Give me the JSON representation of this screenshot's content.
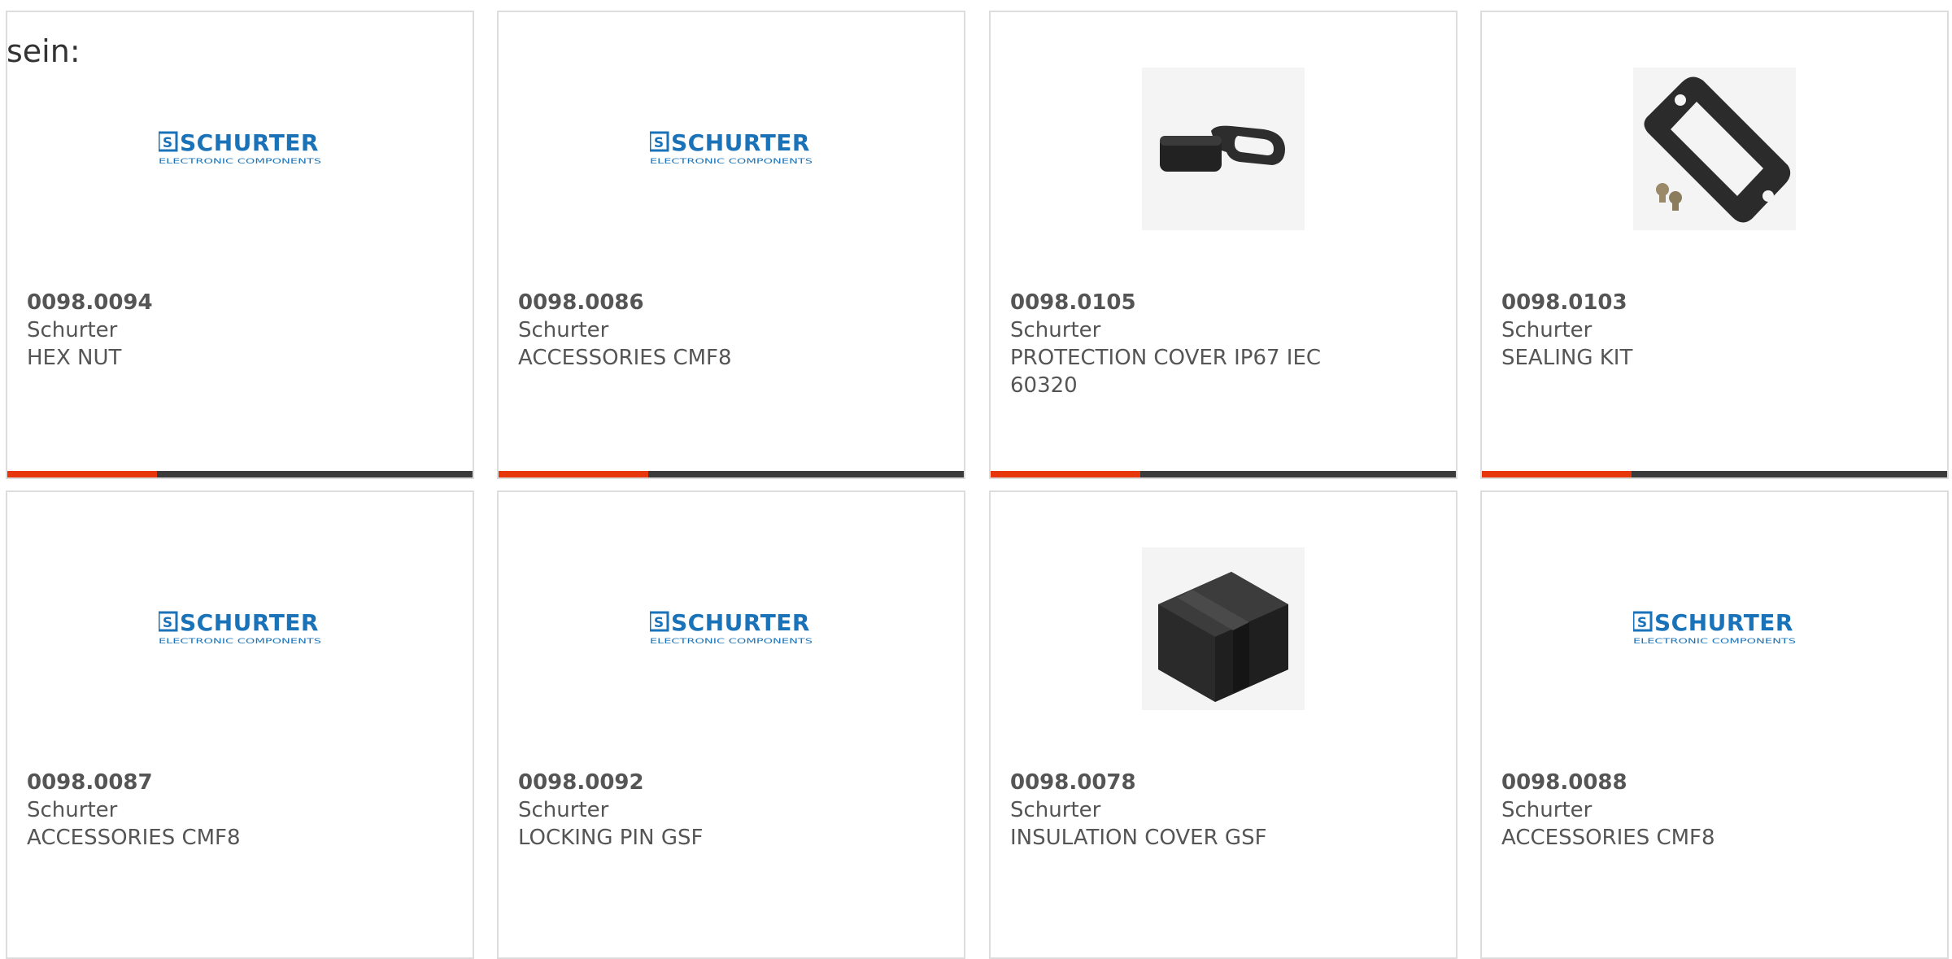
{
  "intro_text": "sein:",
  "colors": {
    "accent": "#e8360c",
    "bar": "#3b3b3b",
    "brand_blue": "#1a73b8"
  },
  "logo": {
    "brand": "SCHURTER",
    "tagline": "ELECTRONIC COMPONENTS",
    "mark": "S"
  },
  "products": [
    {
      "part_number": "0098.0094",
      "manufacturer": "Schurter",
      "description": "HEX NUT",
      "image": "schurter-logo"
    },
    {
      "part_number": "0098.0086",
      "manufacturer": "Schurter",
      "description": "ACCESSORIES CMF8",
      "image": "schurter-logo"
    },
    {
      "part_number": "0098.0105",
      "manufacturer": "Schurter",
      "description": "PROTECTION COVER IP67 IEC 60320",
      "image": "protection-cover"
    },
    {
      "part_number": "0098.0103",
      "manufacturer": "Schurter",
      "description": "SEALING KIT",
      "image": "sealing-gasket"
    },
    {
      "part_number": "0098.0087",
      "manufacturer": "Schurter",
      "description": "ACCESSORIES CMF8",
      "image": "schurter-logo"
    },
    {
      "part_number": "0098.0092",
      "manufacturer": "Schurter",
      "description": "LOCKING PIN GSF",
      "image": "schurter-logo"
    },
    {
      "part_number": "0098.0078",
      "manufacturer": "Schurter",
      "description": "INSULATION COVER GSF",
      "image": "insulation-cover"
    },
    {
      "part_number": "0098.0088",
      "manufacturer": "Schurter",
      "description": "ACCESSORIES CMF8",
      "image": "schurter-logo"
    }
  ]
}
